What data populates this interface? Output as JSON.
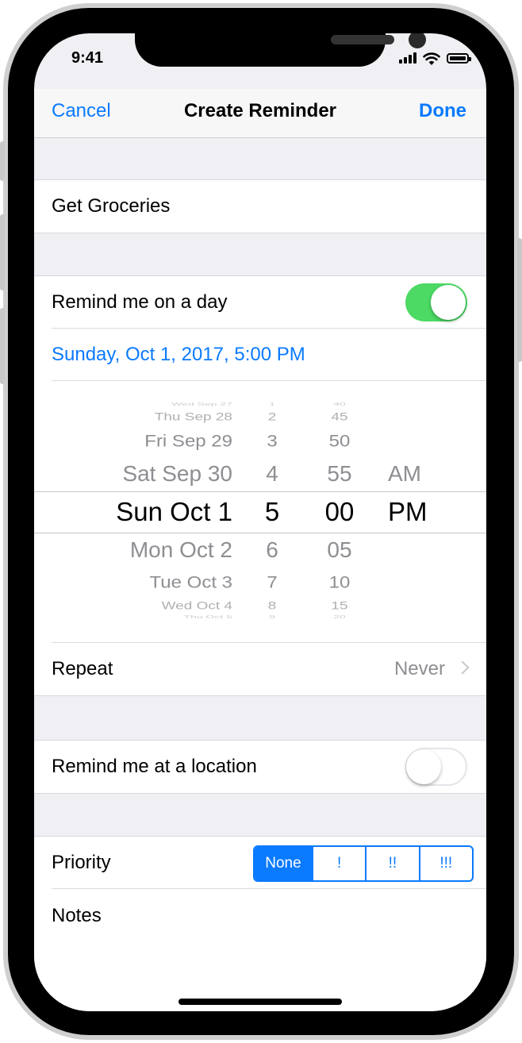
{
  "status_bar": {
    "time": "9:41"
  },
  "nav": {
    "cancel": "Cancel",
    "title": "Create Reminder",
    "done": "Done"
  },
  "reminder": {
    "title": "Get Groceries"
  },
  "remind_day": {
    "label": "Remind me on a day",
    "enabled": true,
    "date_text": "Sunday, Oct 1, 2017, 5:00 PM"
  },
  "picker": {
    "days": [
      "Wed Sep 27",
      "Thu Sep 28",
      "Fri Sep 29",
      "Sat Sep 30",
      "Sun Oct 1",
      "Mon Oct 2",
      "Tue Oct 3",
      "Wed Oct 4",
      "Thu Oct 5"
    ],
    "hours": [
      "1",
      "2",
      "3",
      "4",
      "5",
      "6",
      "7",
      "8",
      "9"
    ],
    "minutes": [
      "40",
      "45",
      "50",
      "55",
      "00",
      "05",
      "10",
      "15",
      "20"
    ],
    "ampm": [
      "AM",
      "PM"
    ],
    "selected_index": 4
  },
  "repeat": {
    "label": "Repeat",
    "value": "Never"
  },
  "location": {
    "label": "Remind me at a location",
    "enabled": false
  },
  "priority": {
    "label": "Priority",
    "options": [
      "None",
      "!",
      "!!",
      "!!!"
    ],
    "selected": "None"
  },
  "notes": {
    "label": "Notes"
  },
  "colors": {
    "accent": "#0a7aff",
    "toggle_on": "#4cd964",
    "secondary_text": "#8e8e93",
    "grouped_background": "#efeff4"
  }
}
